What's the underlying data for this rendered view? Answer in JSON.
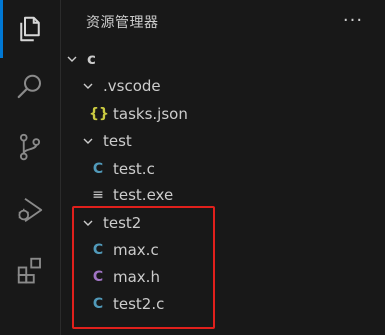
{
  "explorer": {
    "title": "资源管理器",
    "more_label": "···"
  },
  "tree": {
    "root": {
      "label": "c"
    },
    "vscode": {
      "label": ".vscode"
    },
    "tasks_json": {
      "icon": "{}",
      "label": "tasks.json"
    },
    "test": {
      "label": "test"
    },
    "test_c": {
      "icon": "C",
      "label": "test.c"
    },
    "test_exe": {
      "icon": "≡",
      "label": "test.exe"
    },
    "test2": {
      "label": "test2"
    },
    "max_c": {
      "icon": "C",
      "label": "max.c"
    },
    "max_h": {
      "icon": "C",
      "label": "max.h"
    },
    "test2_c": {
      "icon": "C",
      "label": "test2.c"
    }
  },
  "activity_bar": {
    "items": [
      "explorer-icon",
      "search-icon",
      "source-control-icon",
      "run-debug-icon",
      "extensions-icon"
    ]
  },
  "colors": {
    "c_icon": "#519aba",
    "h_icon": "#a074c4",
    "json_icon": "#cbcb41",
    "highlight": "#e0201c",
    "accent": "#0078d4"
  }
}
